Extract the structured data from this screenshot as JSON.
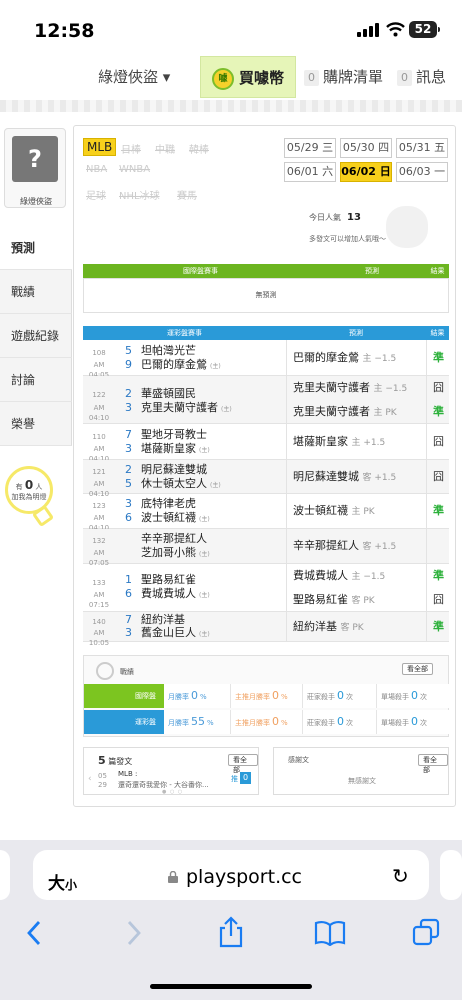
{
  "status_bar": {
    "time": "12:58",
    "battery": "52"
  },
  "top_nav": {
    "user_menu": "綠燈俠盜 ▾",
    "buy_coin": "買噱幣",
    "coin_badge": "噱",
    "cart_count": "0",
    "cart_label": "購牌清單",
    "msg_count": "0",
    "msg_label": "訊息"
  },
  "sidebar": {
    "username": "綠燈俠盜",
    "items": [
      {
        "label": "預測",
        "active": true
      },
      {
        "label": "戰績",
        "active": false
      },
      {
        "label": "遊戲紀錄",
        "active": false
      },
      {
        "label": "討論",
        "active": false
      },
      {
        "label": "榮譽",
        "active": false
      }
    ],
    "bulb_prefix": "有",
    "bulb_count": "0",
    "bulb_unit": "人",
    "bulb_caption": "加我為明燈"
  },
  "leagues": [
    "MLB",
    "日棒",
    "中職",
    "韓棒",
    "NBA",
    "WNBA",
    "足球",
    "NHL冰球",
    "賽馬"
  ],
  "dates": [
    {
      "label": "05/29 三",
      "selected": false
    },
    {
      "label": "05/30 四",
      "selected": false
    },
    {
      "label": "05/31 五",
      "selected": false
    },
    {
      "label": "06/01 六",
      "selected": false
    },
    {
      "label": "06/02 日",
      "selected": true
    },
    {
      "label": "06/03 一",
      "selected": false
    }
  ],
  "views": {
    "label": "今日人氣",
    "count": "13",
    "hint": "多發文可以增加人氣哦～"
  },
  "intl_table": {
    "header_game": "國際盤賽事",
    "header_pred": "預測",
    "header_result": "結果",
    "empty": "無預測"
  },
  "lottery_table": {
    "header_game": "運彩盤賽事",
    "header_pred": "預測",
    "header_result": "結果",
    "rows": [
      {
        "id": "108",
        "time": "AM 04:05",
        "n1": "5",
        "t1": "坦帕灣光芒",
        "n2": "9",
        "t2": "巴爾的摩金鶯",
        "t2_tag": "(主)",
        "picks": [
          {
            "team": "巴爾的摩金鶯",
            "meta": "主 −1.5",
            "result": "準"
          }
        ]
      },
      {
        "id": "122",
        "time": "AM 04:10",
        "n1": "2",
        "t1": "華盛頓國民",
        "n2": "3",
        "t2": "克里夫蘭守護者",
        "t2_tag": "(主)",
        "picks": [
          {
            "team": "克里夫蘭守護者",
            "meta": "主 −1.5",
            "result": "囧"
          },
          {
            "team": "克里夫蘭守護者",
            "meta": "主 PK",
            "result": "準"
          }
        ]
      },
      {
        "id": "110",
        "time": "AM 04:10",
        "n1": "7",
        "t1": "聖地牙哥教士",
        "n2": "3",
        "t2": "堪薩斯皇家",
        "t2_tag": "(主)",
        "picks": [
          {
            "team": "堪薩斯皇家",
            "meta": "主 +1.5",
            "result": "囧"
          }
        ]
      },
      {
        "id": "121",
        "time": "AM 04:10",
        "n1": "2",
        "t1": "明尼蘇達雙城",
        "n2": "5",
        "t2": "休士頓太空人",
        "t2_tag": "(主)",
        "picks": [
          {
            "team": "明尼蘇達雙城",
            "meta": "客 +1.5",
            "result": "囧"
          }
        ]
      },
      {
        "id": "123",
        "time": "AM 04:10",
        "n1": "3",
        "t1": "底特律老虎",
        "n2": "6",
        "t2": "波士頓紅襪",
        "t2_tag": "(主)",
        "picks": [
          {
            "team": "波士頓紅襪",
            "meta": "主 PK",
            "result": "準"
          }
        ]
      },
      {
        "id": "132",
        "time": "AM 07:05",
        "n1": "",
        "t1": "辛辛那提紅人",
        "n2": "",
        "t2": "芝加哥小熊",
        "t2_tag": "(主)",
        "picks": [
          {
            "team": "辛辛那提紅人",
            "meta": "客 +1.5",
            "result": ""
          }
        ]
      },
      {
        "id": "133",
        "time": "AM 07:15",
        "n1": "1",
        "t1": "聖路易紅雀",
        "n2": "6",
        "t2": "費城費城人",
        "t2_tag": "(主)",
        "picks": [
          {
            "team": "費城費城人",
            "meta": "主 −1.5",
            "result": "準"
          },
          {
            "team": "聖路易紅雀",
            "meta": "客 PK",
            "result": "囧"
          }
        ]
      },
      {
        "id": "140",
        "time": "AM 10:05",
        "n1": "7",
        "t1": "紐約洋基",
        "n2": "3",
        "t2": "舊金山巨人",
        "t2_tag": "(主)",
        "picks": [
          {
            "team": "紐約洋基",
            "meta": "客 PK",
            "result": "準"
          }
        ]
      }
    ]
  },
  "stats": {
    "label": "戰績",
    "view_all": "看全部",
    "rows": [
      {
        "tag": "國際盤",
        "color": "#7cc520",
        "month_label": "月勝率",
        "month_val": "0",
        "month_unit": "%",
        "main_label": "主推月勝率",
        "main_val": "0",
        "main_unit": "%",
        "home_label": "莊家殺手",
        "home_val": "0",
        "home_unit": "次",
        "single_label": "單場殺手",
        "single_val": "0",
        "single_unit": "次"
      },
      {
        "tag": "運彩盤",
        "color": "#2a9ad8",
        "month_label": "月勝率",
        "month_val": "55",
        "month_unit": "%",
        "main_label": "主推月勝率",
        "main_val": "0",
        "main_unit": "%",
        "home_label": "莊家殺手",
        "home_val": "0",
        "home_unit": "次",
        "single_label": "單場殺手",
        "single_val": "0",
        "single_unit": "次"
      }
    ]
  },
  "posts": {
    "count": "5",
    "label": "篇發文",
    "view_all": "看全部",
    "date_mm": "05",
    "date_dd": "29",
    "league": "MLB :",
    "title": "還奇還奇我愛你 - 大谷番你...",
    "push": "推",
    "push_count": "0"
  },
  "thanks": {
    "label": "感謝文",
    "view_all": "看全部",
    "empty": "無感謝文"
  },
  "safari": {
    "aa": "大",
    "aa_small": "小",
    "url": "playsport.cc"
  }
}
